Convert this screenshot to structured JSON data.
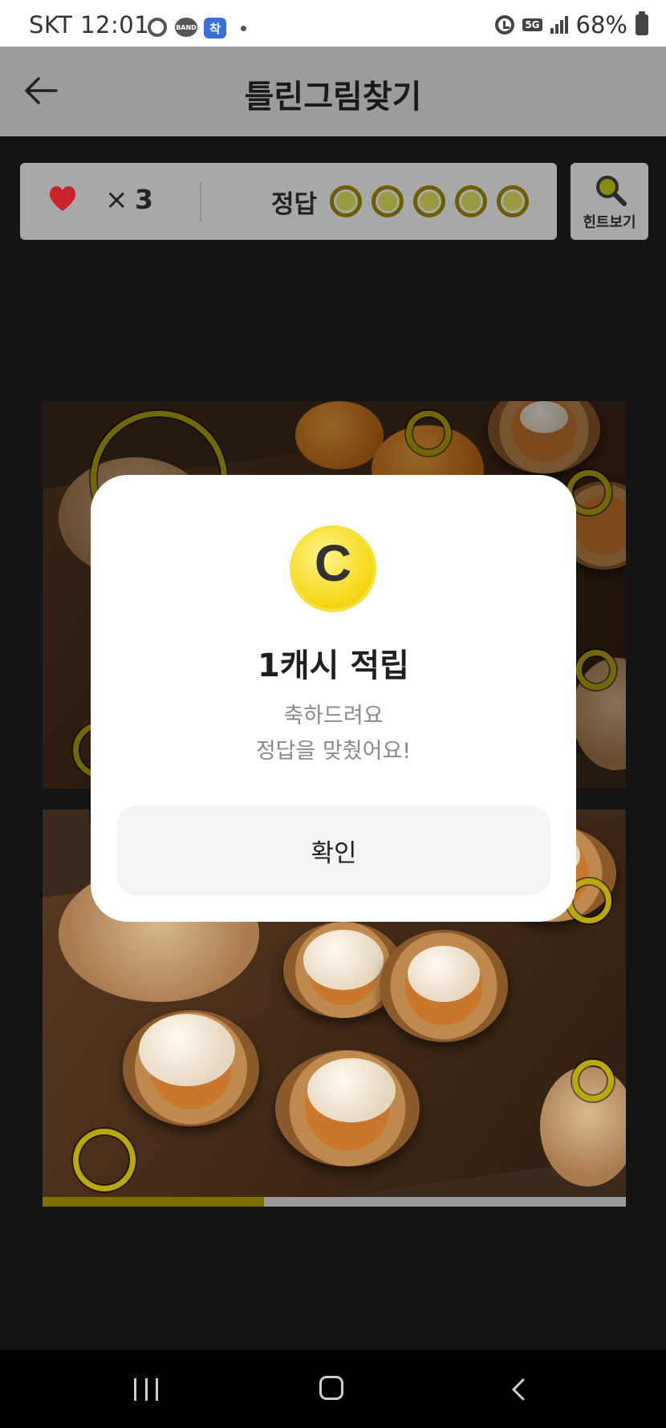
{
  "status_bar": {
    "carrier_time": "SKT 12:01",
    "band_label": "BAND",
    "app_badge": "착",
    "network": "5G",
    "battery": "68%"
  },
  "header": {
    "title": "틀린그림찾기"
  },
  "score_panel": {
    "lives_symbol": "×",
    "lives": "3",
    "answer_label": "정답",
    "answers_total": 5,
    "answers_found": 5,
    "hint_label": "힌트보기"
  },
  "progress": {
    "fraction": 0.38
  },
  "modal": {
    "coin_letter": "C",
    "title": "1캐시 적립",
    "message_line1": "축하드려요",
    "message_line2": "정답을 맞췄어요!",
    "confirm_label": "확인"
  },
  "colors": {
    "accent_yellow": "#f6d91a",
    "ring_yellow": "#b9a90f",
    "heart_red": "#c8222a"
  },
  "icons": {
    "back": "arrow-left-icon",
    "heart": "heart-icon",
    "hint": "magnifier-icon",
    "coin": "coin-icon",
    "nav_recent": "recent-apps-icon",
    "nav_home": "home-icon",
    "nav_back": "chevron-left-icon"
  }
}
